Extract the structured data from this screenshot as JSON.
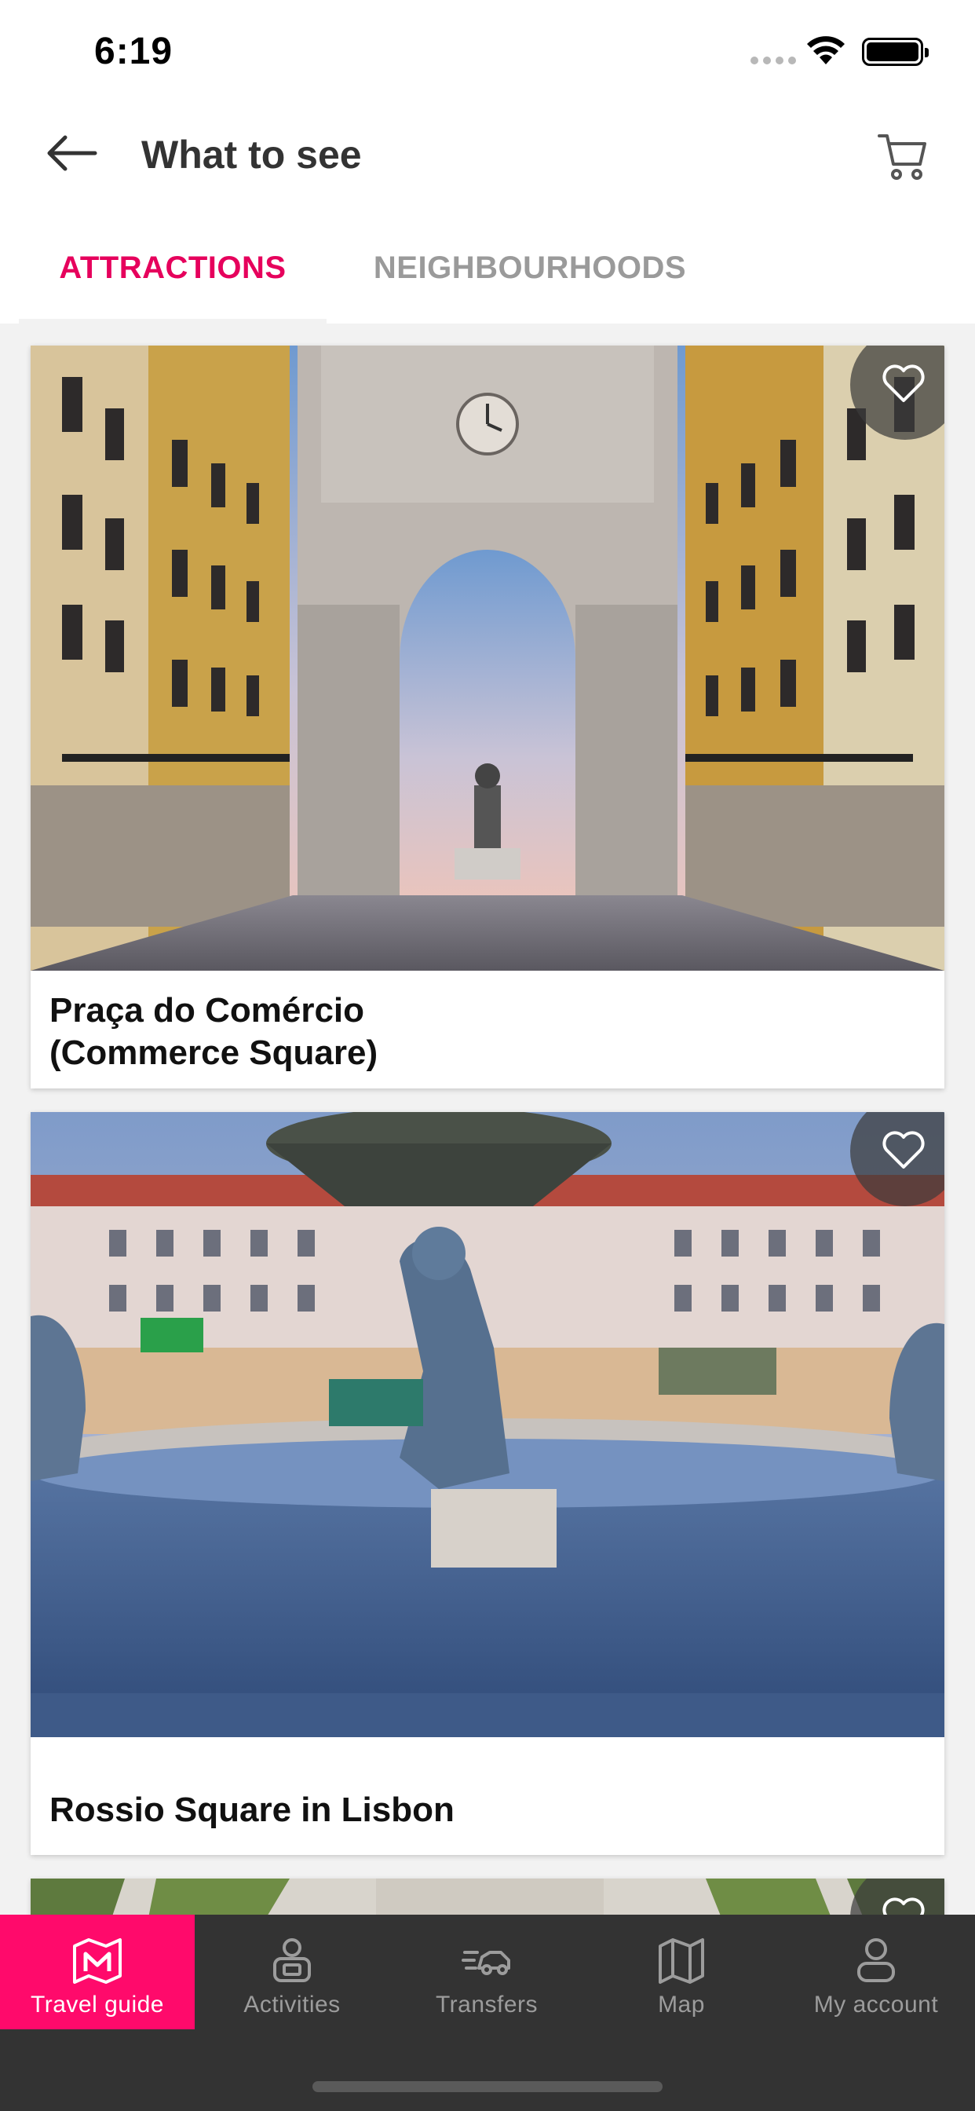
{
  "status_bar": {
    "time": "6:19"
  },
  "header": {
    "title": "What to see"
  },
  "tabs": [
    {
      "label": "ATTRACTIONS",
      "active": true
    },
    {
      "label": "NEIGHBOURHOODS",
      "active": false
    }
  ],
  "cards": [
    {
      "title": "Praça do Comércio\n(Commerce Square)",
      "image": "arch-street-photo"
    },
    {
      "title": "Rossio Square in Lisbon",
      "image": "fountain-square-photo"
    },
    {
      "title": "",
      "image": "aerial-photo"
    }
  ],
  "bottom_nav": [
    {
      "label": "Travel guide",
      "icon": "map-marker-icon",
      "active": true
    },
    {
      "label": "Activities",
      "icon": "activities-icon",
      "active": false
    },
    {
      "label": "Transfers",
      "icon": "car-icon",
      "active": false
    },
    {
      "label": "Map",
      "icon": "map-icon",
      "active": false
    },
    {
      "label": "My account",
      "icon": "user-icon",
      "active": false
    }
  ],
  "colors": {
    "accent": "#e6005c",
    "nav_active_bg": "#ff0a6b",
    "nav_bg": "#333333"
  }
}
